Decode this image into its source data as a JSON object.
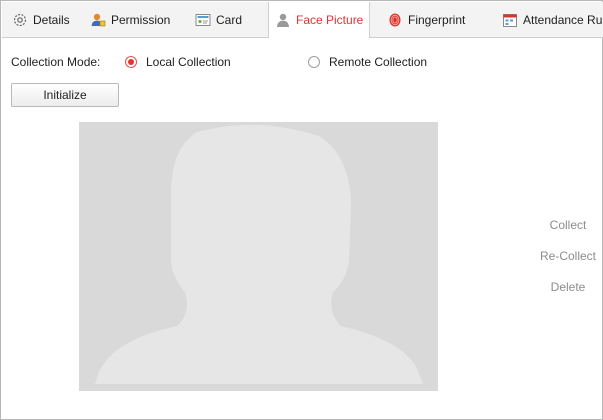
{
  "tabs": [
    {
      "label": "Details",
      "icon": "gear-icon",
      "active": false
    },
    {
      "label": "Permission",
      "icon": "user-lock-icon",
      "active": false
    },
    {
      "label": "Card",
      "icon": "card-icon",
      "active": false
    },
    {
      "label": "Face Picture",
      "icon": "person-icon",
      "active": true
    },
    {
      "label": "Fingerprint",
      "icon": "fingerprint-icon",
      "active": false
    },
    {
      "label": "Attendance Rul",
      "icon": "calendar-icon",
      "active": false
    }
  ],
  "collection": {
    "label": "Collection Mode:",
    "options": [
      {
        "label": "Local Collection",
        "checked": true
      },
      {
        "label": "Remote Collection",
        "checked": false
      }
    ]
  },
  "initialize_label": "Initialize",
  "actions": {
    "collect": "Collect",
    "recollect": "Re-Collect",
    "delete": "Delete"
  },
  "colors": {
    "accent": "#e0362f",
    "photo_bg": "#d9d9d9",
    "silhouette": "#e6e6e6",
    "disabled_text": "#8c8c8c"
  }
}
